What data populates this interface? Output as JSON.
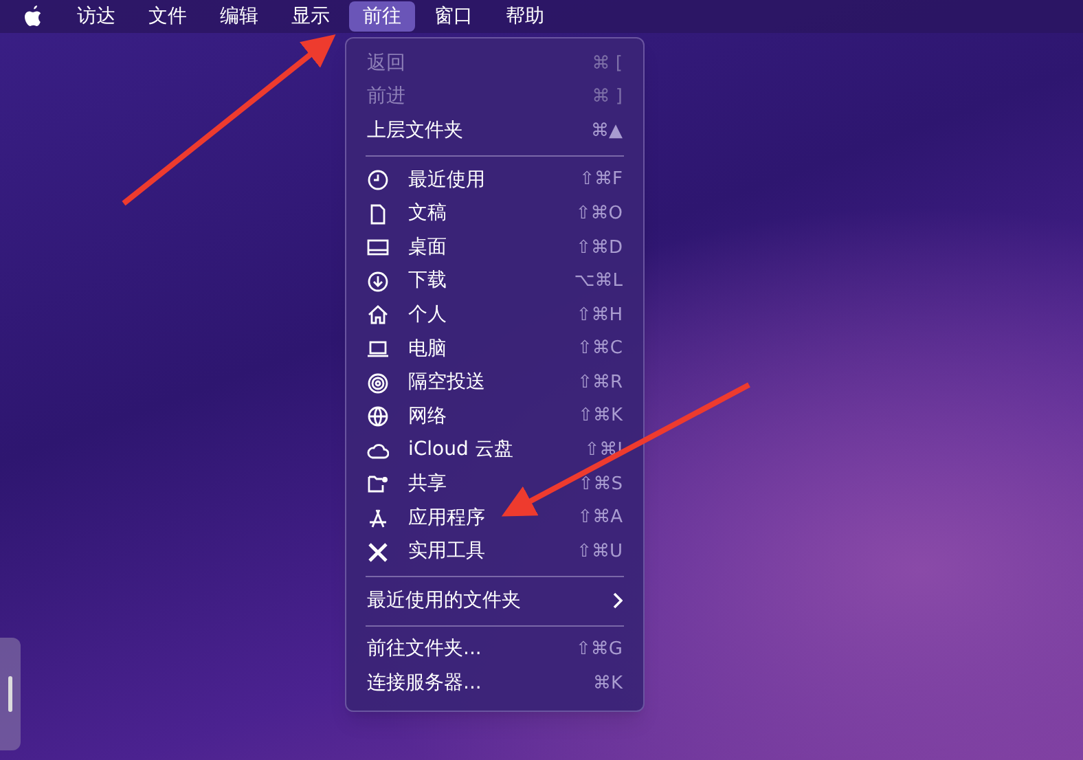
{
  "menu_bar": {
    "items": [
      {
        "label": "访达",
        "selected": false
      },
      {
        "label": "文件",
        "selected": false
      },
      {
        "label": "编辑",
        "selected": false
      },
      {
        "label": "显示",
        "selected": false
      },
      {
        "label": "前往",
        "selected": true
      },
      {
        "label": "窗口",
        "selected": false
      },
      {
        "label": "帮助",
        "selected": false
      }
    ]
  },
  "menu": {
    "sections": [
      [
        {
          "kind": "plain",
          "label": "返回",
          "shortcut": "⌘ [",
          "disabled": true
        },
        {
          "kind": "plain",
          "label": "前进",
          "shortcut": "⌘ ]",
          "disabled": true
        },
        {
          "kind": "plain",
          "label": "上层文件夹",
          "shortcut": "⌘▲",
          "disabled": false
        }
      ],
      [
        {
          "kind": "place",
          "label": "最近使用",
          "shortcut": "⇧⌘F",
          "disabled": false
        },
        {
          "kind": "place",
          "label": "文稿",
          "shortcut": "⇧⌘O",
          "disabled": false
        },
        {
          "kind": "place",
          "label": "桌面",
          "shortcut": "⇧⌘D",
          "disabled": false
        },
        {
          "kind": "place",
          "label": "下载",
          "shortcut": "⌥⌘L",
          "disabled": false
        },
        {
          "kind": "place",
          "label": "个人",
          "shortcut": "⇧⌘H",
          "disabled": false
        },
        {
          "kind": "place",
          "label": "电脑",
          "shortcut": "⇧⌘C",
          "disabled": false
        },
        {
          "kind": "place",
          "label": "隔空投送",
          "shortcut": "⇧⌘R",
          "disabled": false
        },
        {
          "kind": "place",
          "label": "网络",
          "shortcut": "⇧⌘K",
          "disabled": false
        },
        {
          "kind": "place",
          "label": "iCloud 云盘",
          "shortcut": "⇧⌘I",
          "disabled": false
        },
        {
          "kind": "place",
          "label": "共享",
          "shortcut": "⇧⌘S",
          "disabled": false
        },
        {
          "kind": "place",
          "label": "应用程序",
          "shortcut": "⇧⌘A",
          "disabled": false
        },
        {
          "kind": "place",
          "label": "实用工具",
          "shortcut": "⇧⌘U",
          "disabled": false
        }
      ],
      [
        {
          "kind": "submenu",
          "label": "最近使用的文件夹",
          "disabled": false
        }
      ],
      [
        {
          "kind": "plain",
          "label": "前往文件夹...",
          "shortcut": "⇧⌘G",
          "disabled": false
        },
        {
          "kind": "plain",
          "label": "连接服务器...",
          "shortcut": "⌘K",
          "disabled": false
        }
      ]
    ]
  }
}
